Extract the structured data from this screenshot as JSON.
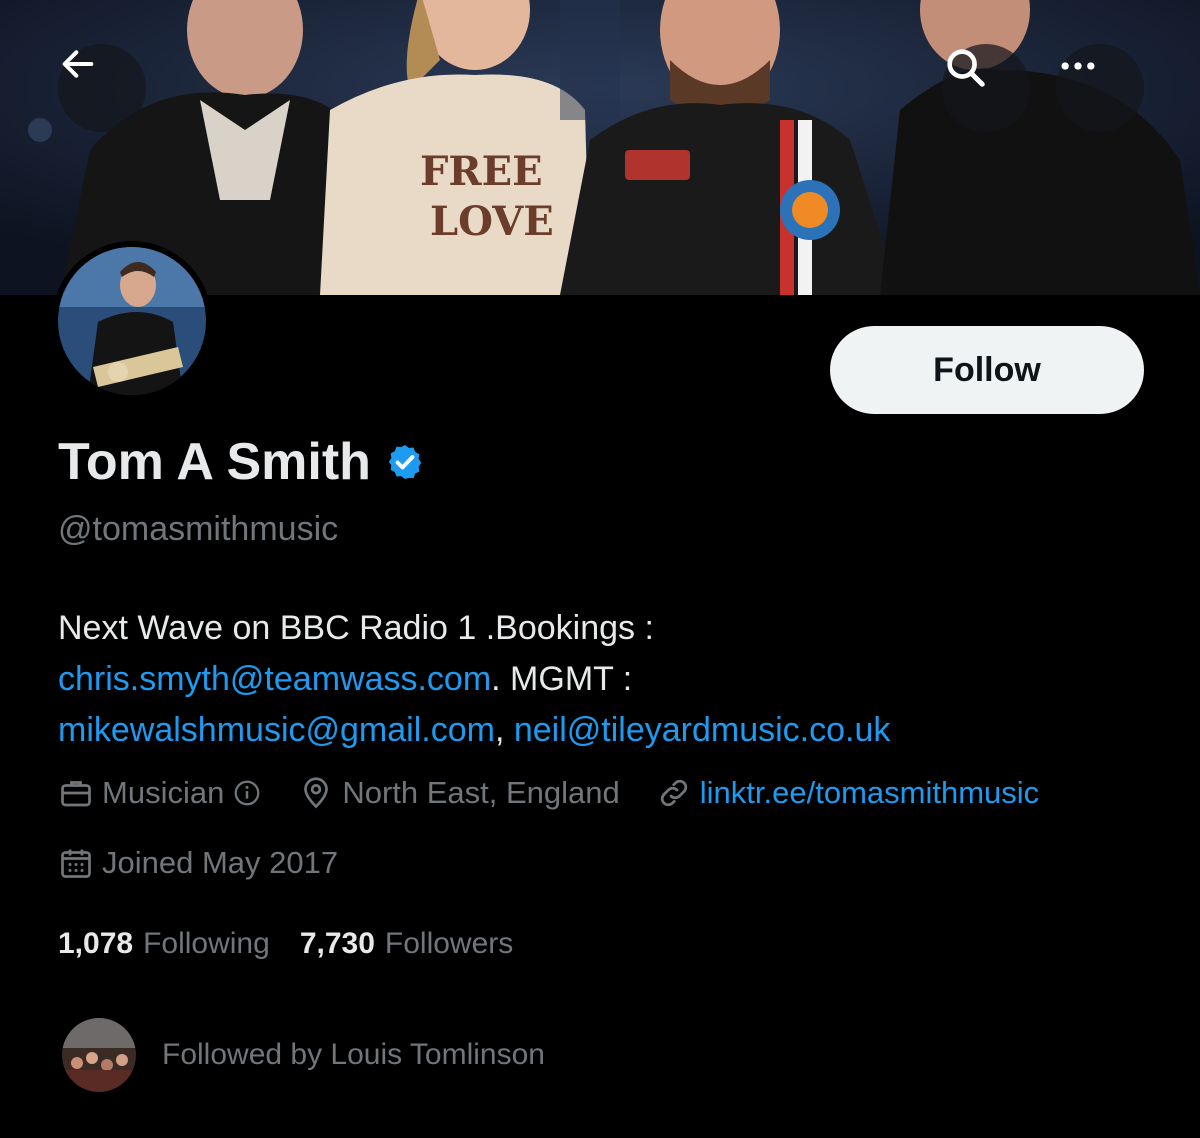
{
  "header": {
    "back_icon": "arrow-left-icon",
    "search_icon": "search-icon",
    "more_icon": "more-horizontal-icon"
  },
  "profile": {
    "name": "Tom A Smith",
    "verified": true,
    "handle": "@tomasmithmusic",
    "follow_label": "Follow",
    "bio": {
      "text1": "Next Wave on BBC Radio 1 .Bookings :",
      "email1": "chris.smyth@teamwass.com",
      "text2": ". MGMT :",
      "email2": "mikewalshmusic@gmail.com",
      "sep": ", ",
      "email3": "neil@tileyardmusic.co.uk"
    },
    "category": "Musician",
    "location": "North East, England",
    "website": "linktr.ee/tomasmithmusic",
    "joined": "Joined May 2017",
    "following_count": "1,078",
    "following_label": "Following",
    "followers_count": "7,730",
    "followers_label": "Followers",
    "followed_by": "Followed by Louis Tomlinson"
  },
  "colors": {
    "background": "#000000",
    "link": "#1d9bf0",
    "muted": "#71767b",
    "text": "#e7e9ea",
    "verified": "#1d9bf0"
  }
}
